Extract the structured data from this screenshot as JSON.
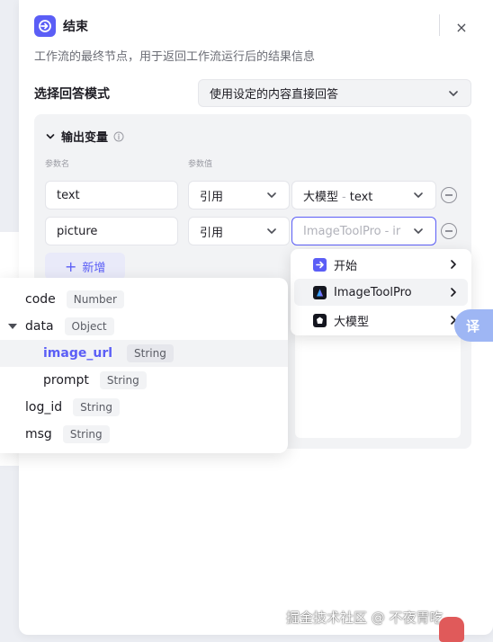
{
  "node": {
    "title": "结束",
    "description": "工作流的最终节点，用于返回工作流运行后的结果信息",
    "close_symbol": "×"
  },
  "answer_mode": {
    "label": "选择回答模式",
    "value": "使用设定的内容直接回答"
  },
  "output": {
    "title": "输出变量",
    "col_name": "参数名",
    "col_value": "参数值",
    "rows": [
      {
        "name": "text",
        "type": "引用",
        "ref_node": "大模型",
        "ref_sep": "-",
        "ref_var": "text"
      },
      {
        "name": "picture",
        "type": "引用",
        "ref_node": "ImageToolPro",
        "ref_sep": "-",
        "ref_var": "ir"
      }
    ],
    "add_label": "新增"
  },
  "ref_dropdown": {
    "items": [
      {
        "label": "开始",
        "icon": "start-node-icon"
      },
      {
        "label": "ImageToolPro",
        "icon": "imagetoolpro-icon"
      },
      {
        "label": "大模型",
        "icon": "llm-node-icon"
      }
    ]
  },
  "var_tree": {
    "items": [
      {
        "name": "code",
        "type": "Number"
      },
      {
        "name": "data",
        "type": "Object"
      },
      {
        "name": "image_url",
        "type": "String"
      },
      {
        "name": "prompt",
        "type": "String"
      },
      {
        "name": "log_id",
        "type": "String"
      },
      {
        "name": "msg",
        "type": "String"
      }
    ]
  },
  "translate_button": "译",
  "watermark": "掘金技术社区 @ 不夜胃吃_",
  "colors": {
    "accent": "#5b5ef6",
    "panel_bg": "#ffffff",
    "section_bg": "#f2f3f5",
    "translate_bg": "#9eb6f4"
  }
}
